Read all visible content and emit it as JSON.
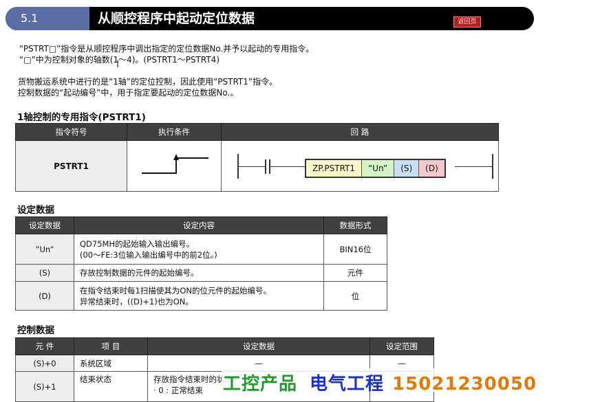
{
  "header": {
    "section_number": "5.1",
    "title": "从顺控程序中起动定位数据",
    "badge": "返回页"
  },
  "intro": {
    "line1": "“PSTRT□”指令是从顺控程序中调出指定的定位数据No.并予以起动的专用指令。",
    "line2": "“□”中为控制对象的轴数(1～4)。(PSTRT1～PSTRT4)",
    "line3": "货物搬运系统中进行的是“1轴”的定位控制，因此使用“PSTRT1”指令。",
    "line4": "控制数据的“起动编号”中，用于指定要起动的定位数据No.。"
  },
  "instruction_section": {
    "heading": "1轴控制的专用指令(PSTRT1)",
    "columns": [
      "指令符号",
      "执行条件",
      "回 路"
    ],
    "symbol": "PSTRT1",
    "ladder": {
      "cells": [
        {
          "text": "ZP.PSTRT1",
          "color": "#fbf6c8"
        },
        {
          "text": "“Un”",
          "color": "#d5f3c4"
        },
        {
          "text": "(S)",
          "color": "#c9def3"
        },
        {
          "text": "(D)",
          "color": "#f5c9cc"
        }
      ]
    }
  },
  "setting_data": {
    "heading": "设定数据",
    "columns": [
      "设定数据",
      "设定内容",
      "数据形式"
    ],
    "rows": [
      {
        "item": "”Un”",
        "content1": "QD75MH的起始输入输出编号。",
        "content2": "(00～FE:3位输入输出编号中的前2位。)",
        "format": "BIN16位"
      },
      {
        "item": "(S)",
        "content1": "存放控制数据的元件的起始编号。",
        "content2": "",
        "format": "元件"
      },
      {
        "item": "(D)",
        "content1": "在指令结束时每1扫描使其为ON的位元件的起始编号。",
        "content2": "异常结束时，((D)+1)也为ON。",
        "format": "位"
      }
    ]
  },
  "control_data": {
    "heading": "控制数据",
    "columns": [
      "元 件",
      "项 目",
      "设定数据",
      "设定范围"
    ],
    "rows": [
      {
        "device": "(S)+0",
        "item": "系统区域",
        "data": "—",
        "range": "—"
      },
      {
        "device": "(S)+1",
        "item": "结束状态",
        "data": "存放指令结束时的状态。",
        "data2": "· 0        : 正常结束",
        "range": "—"
      }
    ]
  },
  "watermark": {
    "part1": "工控产品",
    "part2": "电气工程",
    "part3": "15021230050"
  }
}
